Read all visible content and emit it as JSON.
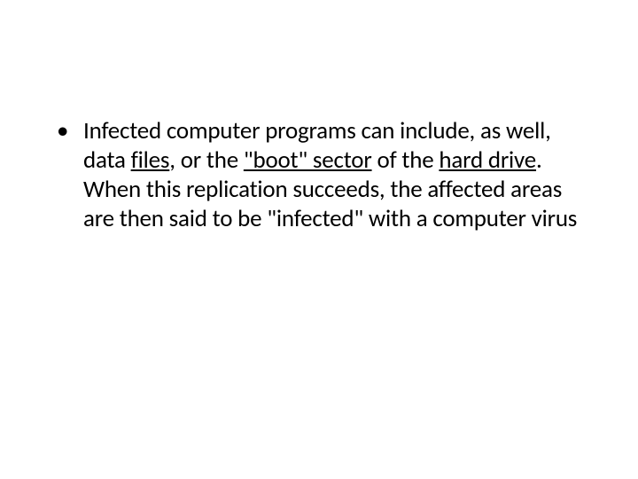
{
  "slide": {
    "bullets": [
      {
        "seg1": "Infected computer programs can include, as well, data ",
        "link1": "files",
        "seg2": ", or the ",
        "link2": "\"boot\" sector",
        "seg3": " of the ",
        "link3": "hard drive",
        "seg4": ". When this replication succeeds, the affected areas are then said to be \"infected\" with a computer virus"
      }
    ]
  }
}
